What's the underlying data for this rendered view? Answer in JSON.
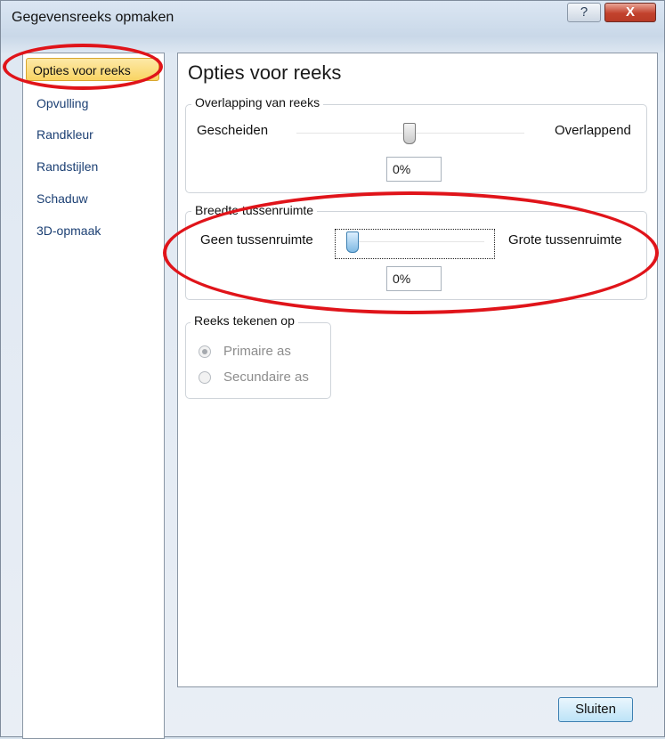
{
  "window": {
    "title": "Gegevensreeks opmaken",
    "help_symbol": "?",
    "close_symbol": "X"
  },
  "sidebar": {
    "items": [
      {
        "label": "Opties voor reeks"
      },
      {
        "label": "Opvulling"
      },
      {
        "label": "Randkleur"
      },
      {
        "label": "Randstijlen"
      },
      {
        "label": "Schaduw"
      },
      {
        "label": "3D-opmaak"
      }
    ]
  },
  "content": {
    "title": "Opties voor reeks",
    "overlap": {
      "group_label": "Overlapping van reeks",
      "left_label": "Gescheiden",
      "right_label": "Overlappend",
      "value": "0%",
      "level_percent": 0
    },
    "gap": {
      "group_label": "Breedte tussenruimte",
      "left_label": "Geen tussenruimte",
      "right_label": "Grote tussenruimte",
      "value": "0%",
      "level_percent": 0
    },
    "axis": {
      "group_label": "Reeks tekenen op",
      "options": [
        {
          "label": "Primaire as",
          "selected": true
        },
        {
          "label": "Secundaire as",
          "selected": false
        }
      ]
    }
  },
  "footer": {
    "close_label": "Sluiten"
  },
  "colors": {
    "annotation": "#e0141a",
    "selected_item": "#f9d463"
  }
}
